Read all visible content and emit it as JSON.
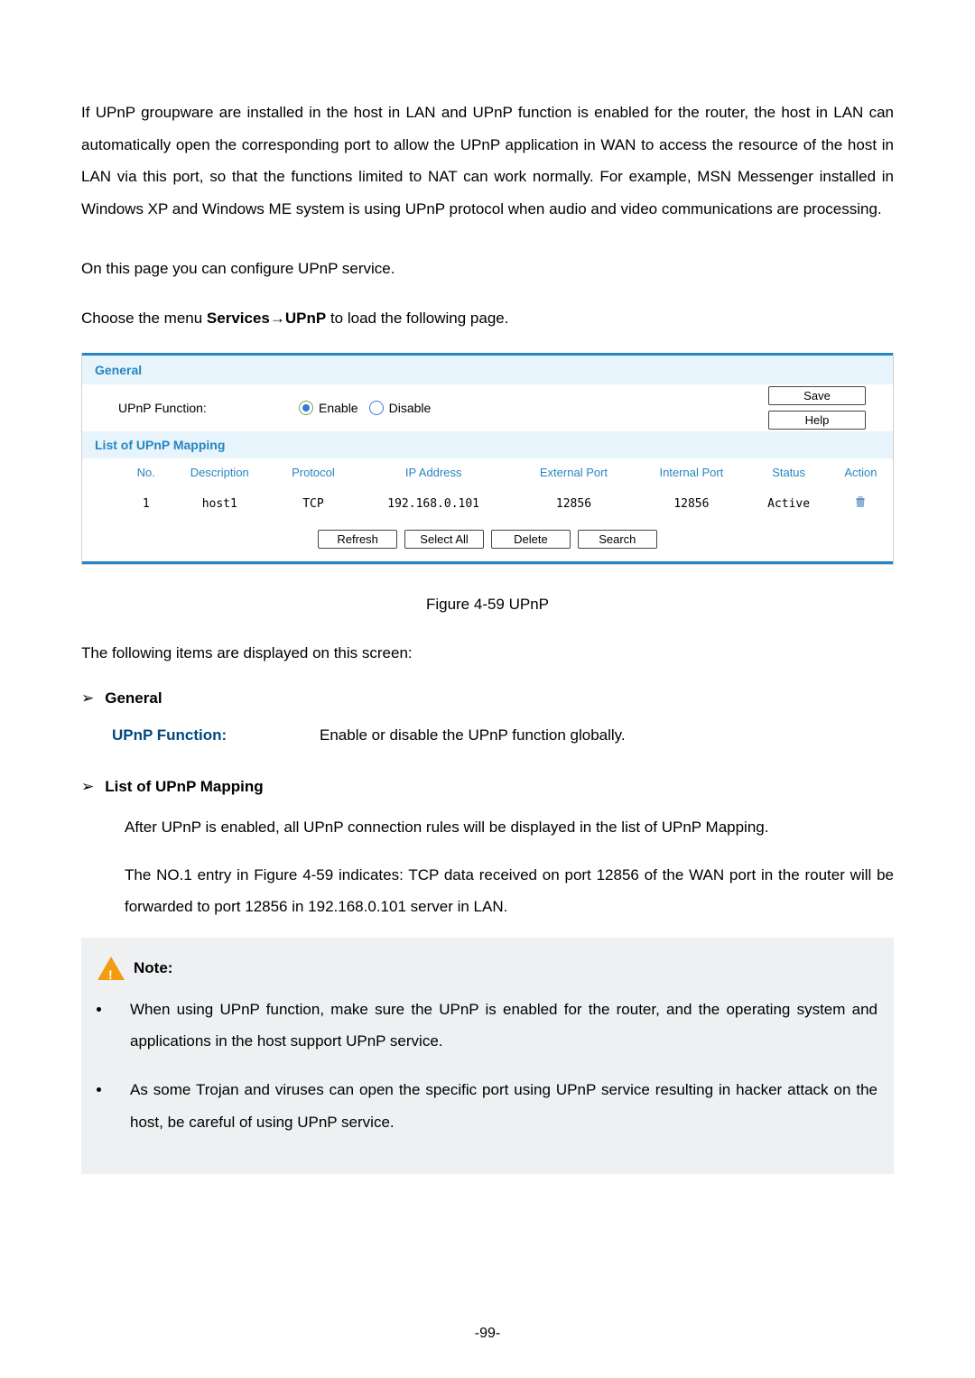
{
  "intro_text": "If UPnP groupware are installed in the host in LAN and UPnP function is enabled for the router, the host in LAN can automatically open the corresponding port to allow the UPnP application in WAN to access the resource of the host in LAN via this port, so that the functions limited to NAT can work normally. For example, MSN Messenger installed in Windows XP and Windows ME system is using UPnP protocol when audio and video communications are processing.",
  "config_text": "On this page you can configure UPnP service.",
  "choose_prefix": "Choose the menu ",
  "choose_bold": "Services→UPnP",
  "choose_suffix": " to load the following page.",
  "panel": {
    "general_header": "General",
    "upnp_label": "UPnP Function:",
    "enable_label": "Enable",
    "disable_label": "Disable",
    "save_btn": "Save",
    "help_btn": "Help",
    "list_header": "List of UPnP Mapping",
    "th": {
      "no": "No.",
      "desc": "Description",
      "proto": "Protocol",
      "ip": "IP Address",
      "ext": "External Port",
      "int": "Internal Port",
      "status": "Status",
      "action": "Action"
    },
    "row": {
      "no": "1",
      "desc": "host1",
      "proto": "TCP",
      "ip": "192.168.0.101",
      "ext": "12856",
      "int": "12856",
      "status": "Active"
    },
    "btns": {
      "refresh": "Refresh",
      "select_all": "Select All",
      "delete": "Delete",
      "search": "Search"
    }
  },
  "figure_caption": "Figure 4-59 UPnP",
  "following_items": "The following items are displayed on this screen:",
  "general_head": "General",
  "upnp_field_label": "UPnP Function:",
  "upnp_field_desc": "Enable or disable the UPnP function globally.",
  "list_head": "List of UPnP Mapping",
  "list_p1": "After UPnP is enabled, all UPnP connection rules will be displayed in the list of UPnP Mapping.",
  "list_p2": "The NO.1 entry in Figure 4-59 indicates: TCP data received on port 12856 of the WAN port in the router will be forwarded to port 12856 in 192.168.0.101 server in LAN.",
  "note_label": "Note:",
  "note1": "When using UPnP function, make sure the UPnP is enabled for the router, and the operating system and applications in the host support UPnP service.",
  "note2": "As some Trojan and viruses can open the specific port using UPnP service resulting in hacker attack on the host, be careful of using UPnP service.",
  "page_number": "-99-"
}
